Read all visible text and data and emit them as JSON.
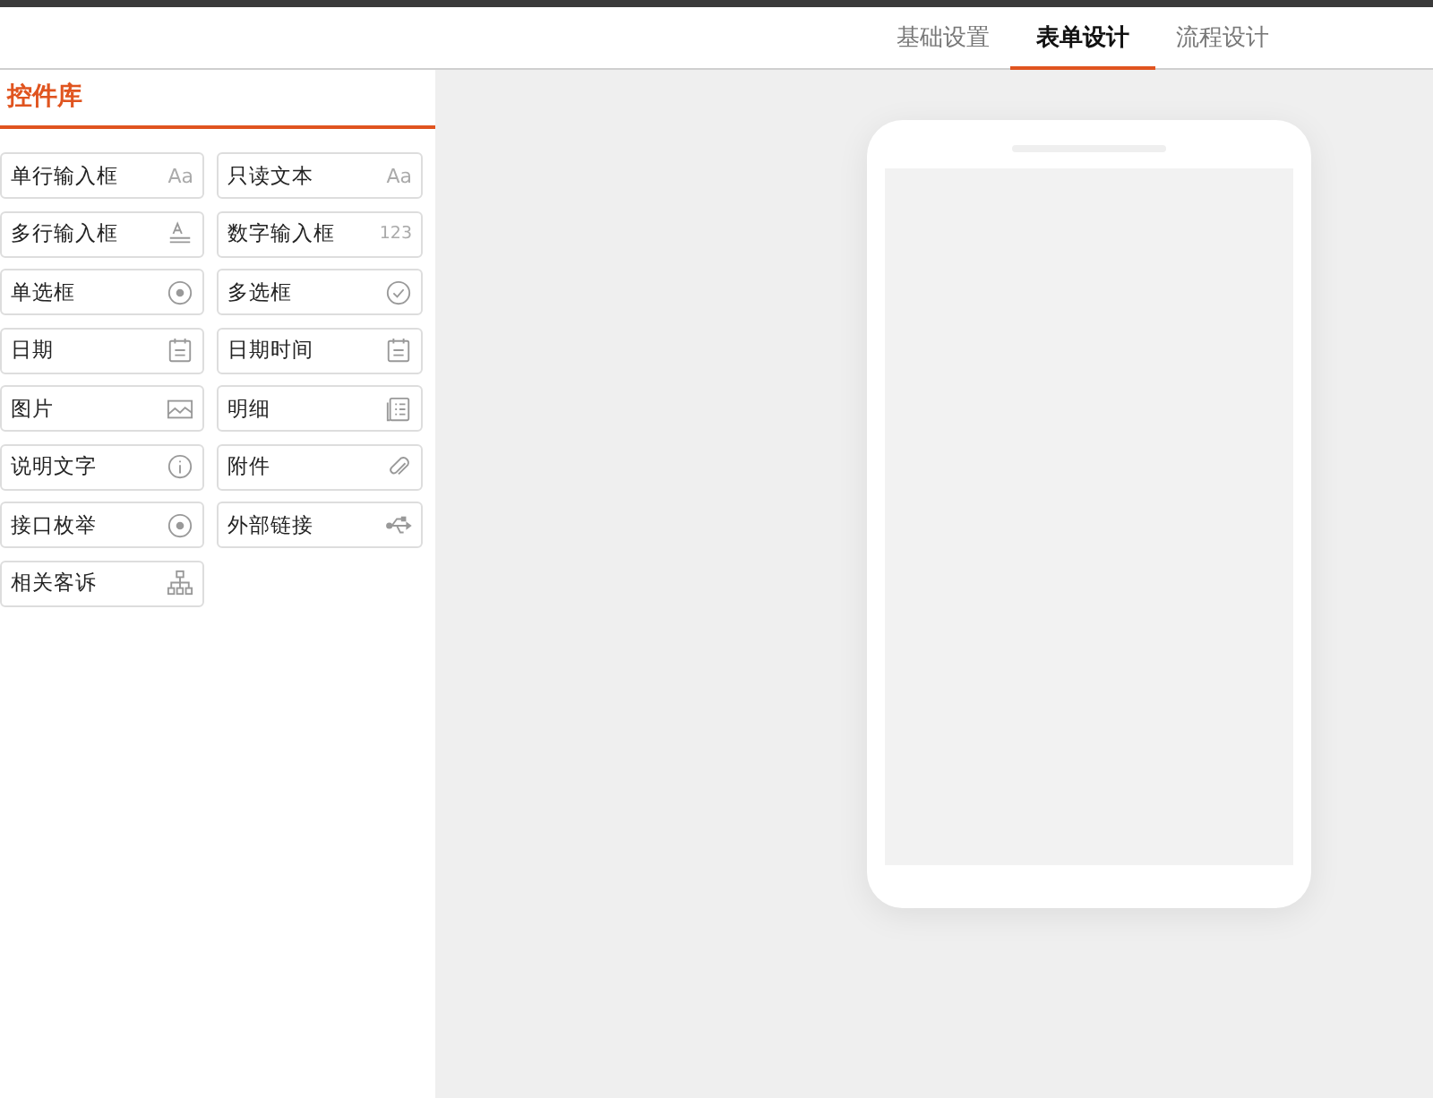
{
  "tabs": [
    {
      "label": "基础设置",
      "selected": false
    },
    {
      "label": "表单设计",
      "selected": true
    },
    {
      "label": "流程设计",
      "selected": false
    }
  ],
  "sidebar": {
    "title": "控件库",
    "items": [
      {
        "label": "单行输入框",
        "kind": "text",
        "icon_text": "Aa"
      },
      {
        "label": "只读文本",
        "kind": "text",
        "icon_text": "Aa"
      },
      {
        "label": "多行输入框",
        "kind": "multiline"
      },
      {
        "label": "数字输入框",
        "kind": "text",
        "icon_text": "123"
      },
      {
        "label": "单选框",
        "kind": "radio"
      },
      {
        "label": "多选框",
        "kind": "check"
      },
      {
        "label": "日期",
        "kind": "calendar"
      },
      {
        "label": "日期时间",
        "kind": "calendar"
      },
      {
        "label": "图片",
        "kind": "image"
      },
      {
        "label": "明细",
        "kind": "list"
      },
      {
        "label": "说明文字",
        "kind": "info"
      },
      {
        "label": "附件",
        "kind": "clip"
      },
      {
        "label": "接口枚举",
        "kind": "radio"
      },
      {
        "label": "外部链接",
        "kind": "usb"
      },
      {
        "label": "相关客诉",
        "kind": "tree"
      }
    ]
  }
}
